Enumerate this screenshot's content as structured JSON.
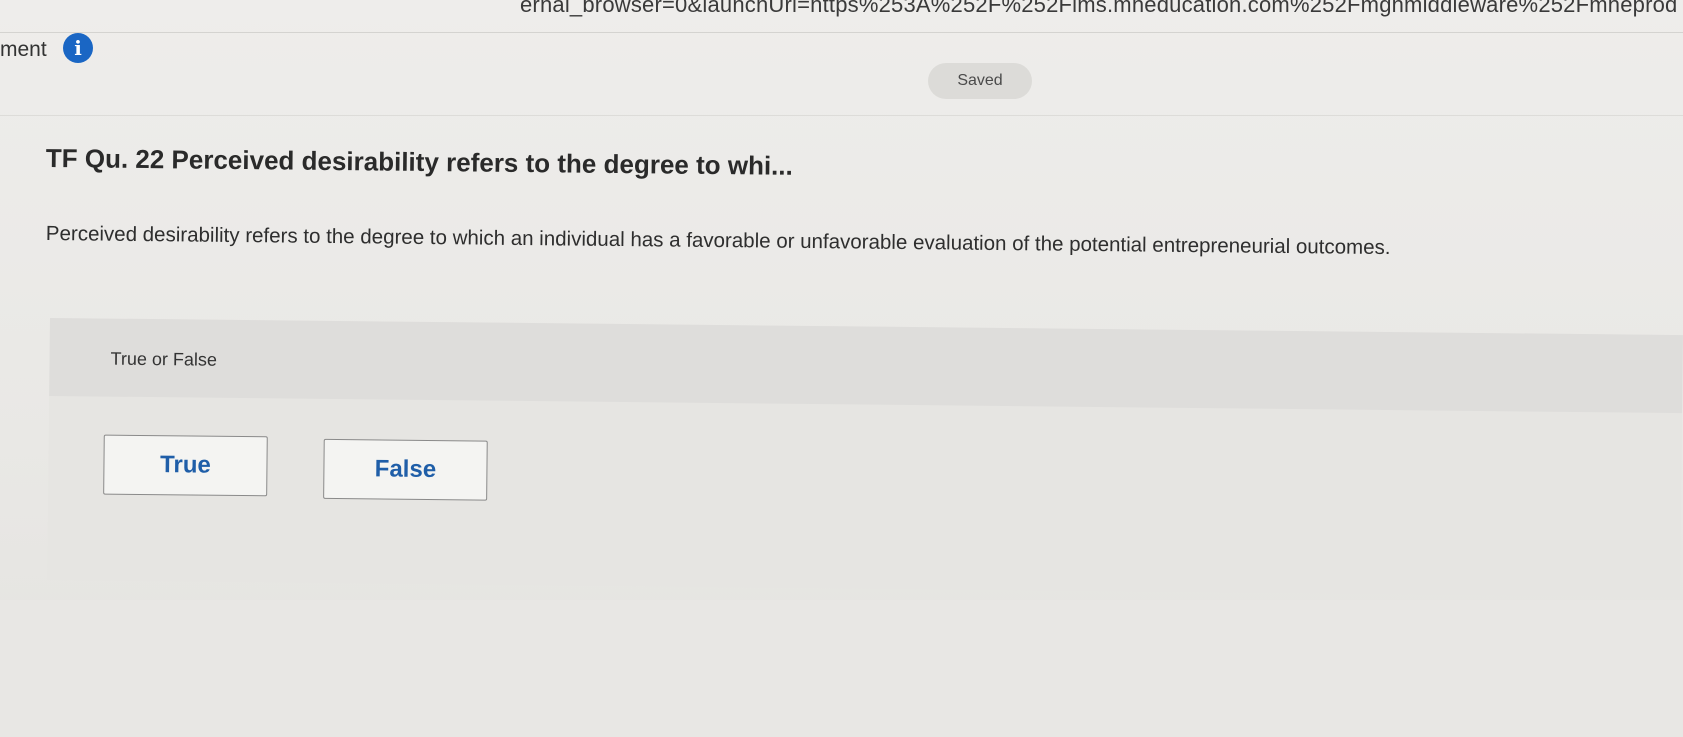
{
  "browser": {
    "url_fragment": "ernal_browser=0&launchUrl=https%253A%252F%252Flms.mheducation.com%252Fmghmiddleware%252Fmheprod"
  },
  "header": {
    "label": "ment",
    "info_icon": "info-icon",
    "saved_status": "Saved"
  },
  "question": {
    "title": "TF Qu. 22 Perceived desirability refers to the degree to whi...",
    "body": "Perceived desirability refers to the degree to which an individual has a favorable or unfavorable evaluation of the potential entrepreneurial outcomes."
  },
  "answer": {
    "type_label": "True or False",
    "choices": [
      {
        "label": "True"
      },
      {
        "label": "False"
      }
    ]
  },
  "colors": {
    "accent": "#1f5ea8",
    "info_icon_bg": "#1a66c4"
  }
}
